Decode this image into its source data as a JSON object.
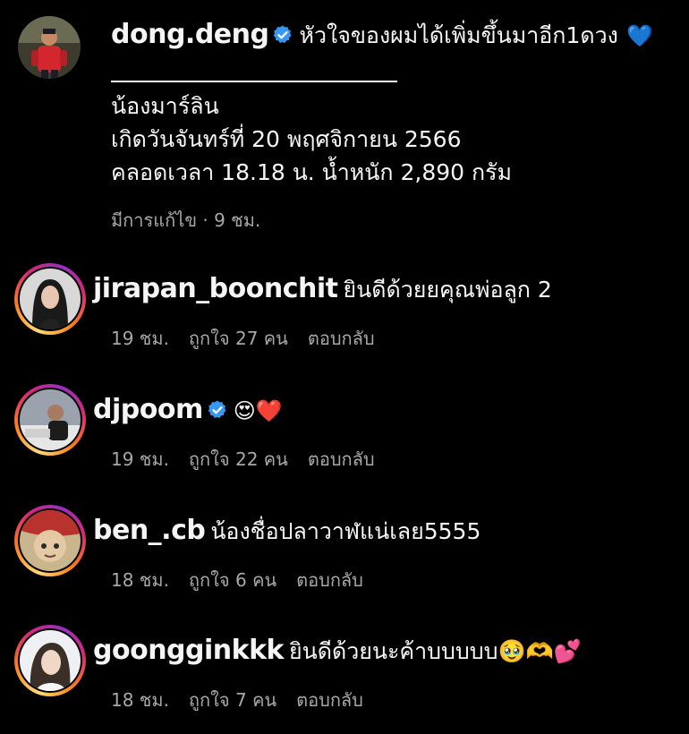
{
  "post": {
    "username": "dong.deng",
    "verified": true,
    "headline": "หัวใจของผมได้เพิ่มขึ้นมาอีก1ดวง",
    "headline_emoji": "💙",
    "body_lines": [
      "น้องมาร์ลิน",
      "เกิดวันจันทร์ที่ 20 พฤศจิกายน 2566",
      "คลอดเวลา 18.18 น. น้ำหนัก 2,890 กรัม"
    ],
    "edited_label": "มีการแก้ไข",
    "separator": "·",
    "time": "9 ชม."
  },
  "comments": [
    {
      "username": "jirapan_boonchit",
      "verified": false,
      "text": "ยินดีด้วยยคุณพ่อลูก 2",
      "time": "19 ชม.",
      "likes": "ถูกใจ 27 คน",
      "reply": "ตอบกลับ"
    },
    {
      "username": "djpoom",
      "verified": true,
      "text": "😍❤️",
      "time": "19 ชม.",
      "likes": "ถูกใจ 22 คน",
      "reply": "ตอบกลับ"
    },
    {
      "username": "ben_.cb",
      "verified": false,
      "text": "น้องชื่อปลาวาฬแน่เลย5555",
      "time": "18 ชม.",
      "likes": "ถูกใจ 6 คน",
      "reply": "ตอบกลับ"
    },
    {
      "username": "goongginkkk",
      "verified": false,
      "text": "ยินดีด้วยนะค้าบบบบบ🥹🫶💕",
      "time": "18 ชม.",
      "likes": "ถูกใจ 7 คน",
      "reply": "ตอบกลับ"
    }
  ],
  "colors": {
    "background": "#000000",
    "text": "#f5f5f5",
    "muted": "#a8a8a8",
    "verified": "#3897f0"
  }
}
